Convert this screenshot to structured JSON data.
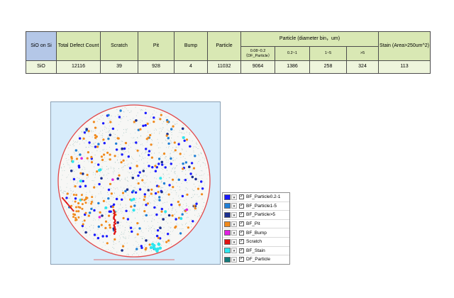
{
  "table": {
    "header": {
      "sample": "SiO on Si",
      "total_defect_count": "Total Defect Count",
      "scratch": "Scratch",
      "pit": "Pit",
      "bump": "Bump",
      "particle": "Particle",
      "particle_bin_group": "Particle (diameter bin，um)",
      "bin_df_range": "0.08~0.2",
      "bin_df_name": "（DF_Particle）",
      "bin_1": "0.2~1",
      "bin_2": "1~5",
      "bin_3": ">5",
      "stain": "Stain (Area>250um^2)"
    },
    "row": {
      "sample": "SiO",
      "total_defect_count": "12116",
      "scratch": "39",
      "pit": "928",
      "bump": "4",
      "particle": "11032",
      "bin_df": "9064",
      "bin_1": "1386",
      "bin_2": "258",
      "bin_3": "324",
      "stain": "113"
    }
  },
  "legend": {
    "items": [
      {
        "label": "BF_Particle0.2-1",
        "color": "#1a1aff"
      },
      {
        "label": "BF_Particle1-5",
        "color": "#1f7fd6"
      },
      {
        "label": "BF_Particle>5",
        "color": "#1b2f8f"
      },
      {
        "label": "BF_Pit",
        "color": "#f08a1c"
      },
      {
        "label": "BF_Bump",
        "color": "#e020e0"
      },
      {
        "label": "Scratch",
        "color": "#e01414"
      },
      {
        "label": "BF_Stain",
        "color": "#2de6ee"
      },
      {
        "label": "DF_Particle",
        "color": "#137a7a"
      }
    ],
    "check_glyph": "✓",
    "dropdown_glyph": "▾"
  },
  "wafer_colors": {
    "panel_bg": "#d7ecfb",
    "wafer_fill": "#f7f7f5",
    "wafer_edge": "#e2494a",
    "df_haze": "#8fb8b5"
  }
}
